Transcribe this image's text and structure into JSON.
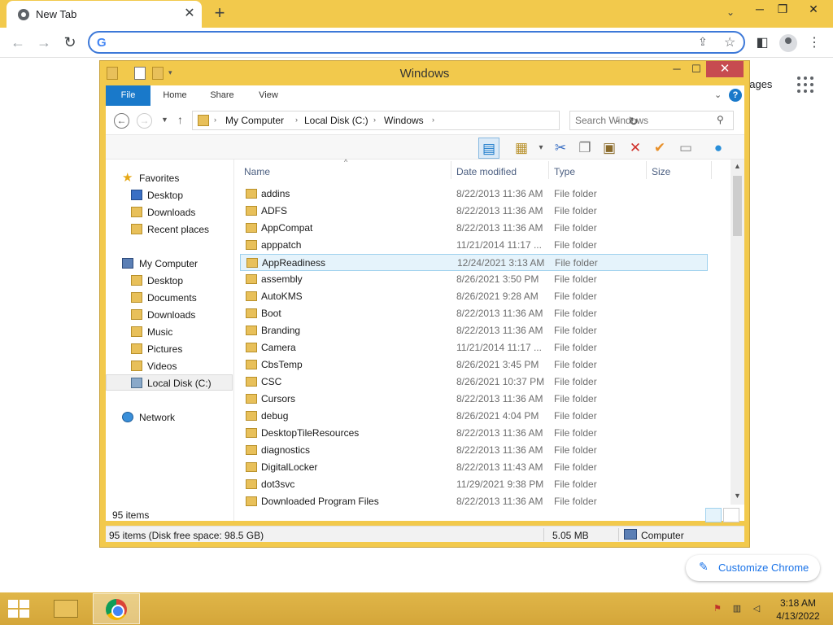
{
  "browser": {
    "tab_title": "New Tab",
    "tab_close": "✕",
    "new_tab": "+",
    "omnibox_value": "",
    "g_logo": "G",
    "ntp_images_link": "nages",
    "customize_label": "Customize Chrome"
  },
  "explorer": {
    "title": "Windows",
    "ribbon_tabs": [
      "File",
      "Home",
      "Share",
      "View"
    ],
    "breadcrumb": [
      "My Computer",
      "Local Disk (C:)",
      "Windows"
    ],
    "search_placeholder": "Search Windows",
    "nav": {
      "favorites": "Favorites",
      "favorites_items": [
        "Desktop",
        "Downloads",
        "Recent places"
      ],
      "computer": "My Computer",
      "computer_items": [
        "Desktop",
        "Documents",
        "Downloads",
        "Music",
        "Pictures",
        "Videos",
        "Local Disk (C:)"
      ],
      "network": "Network"
    },
    "columns": [
      "Name",
      "Date modified",
      "Type",
      "Size"
    ],
    "files": [
      {
        "name": "addins",
        "date": "8/22/2013 11:36 AM",
        "type": "File folder"
      },
      {
        "name": "ADFS",
        "date": "8/22/2013 11:36 AM",
        "type": "File folder"
      },
      {
        "name": "AppCompat",
        "date": "8/22/2013 11:36 AM",
        "type": "File folder"
      },
      {
        "name": "apppatch",
        "date": "11/21/2014 11:17 ...",
        "type": "File folder"
      },
      {
        "name": "AppReadiness",
        "date": "12/24/2021 3:13 AM",
        "type": "File folder"
      },
      {
        "name": "assembly",
        "date": "8/26/2021 3:50 PM",
        "type": "File folder"
      },
      {
        "name": "AutoKMS",
        "date": "8/26/2021 9:28 AM",
        "type": "File folder"
      },
      {
        "name": "Boot",
        "date": "8/22/2013 11:36 AM",
        "type": "File folder"
      },
      {
        "name": "Branding",
        "date": "8/22/2013 11:36 AM",
        "type": "File folder"
      },
      {
        "name": "Camera",
        "date": "11/21/2014 11:17 ...",
        "type": "File folder"
      },
      {
        "name": "CbsTemp",
        "date": "8/26/2021 3:45 PM",
        "type": "File folder"
      },
      {
        "name": "CSC",
        "date": "8/26/2021 10:37 PM",
        "type": "File folder"
      },
      {
        "name": "Cursors",
        "date": "8/22/2013 11:36 AM",
        "type": "File folder"
      },
      {
        "name": "debug",
        "date": "8/26/2021 4:04 PM",
        "type": "File folder"
      },
      {
        "name": "DesktopTileResources",
        "date": "8/22/2013 11:36 AM",
        "type": "File folder"
      },
      {
        "name": "diagnostics",
        "date": "8/22/2013 11:36 AM",
        "type": "File folder"
      },
      {
        "name": "DigitalLocker",
        "date": "8/22/2013 11:43 AM",
        "type": "File folder"
      },
      {
        "name": "dot3svc",
        "date": "11/29/2021 9:38 PM",
        "type": "File folder"
      },
      {
        "name": "Downloaded Program Files",
        "date": "8/22/2013 11:36 AM",
        "type": "File folder"
      }
    ],
    "selected_index": 4,
    "item_count": "95 items",
    "status_items": "95 items (Disk free space: 98.5 GB)",
    "status_size": "5.05 MB",
    "status_location": "Computer"
  },
  "taskbar": {
    "time": "3:18 AM",
    "date": "4/13/2022"
  },
  "colors": {
    "accent": "#f2c94c",
    "file_tab": "#1979ca",
    "close_button": "#c74b50",
    "selection": "#e5f3fb"
  }
}
